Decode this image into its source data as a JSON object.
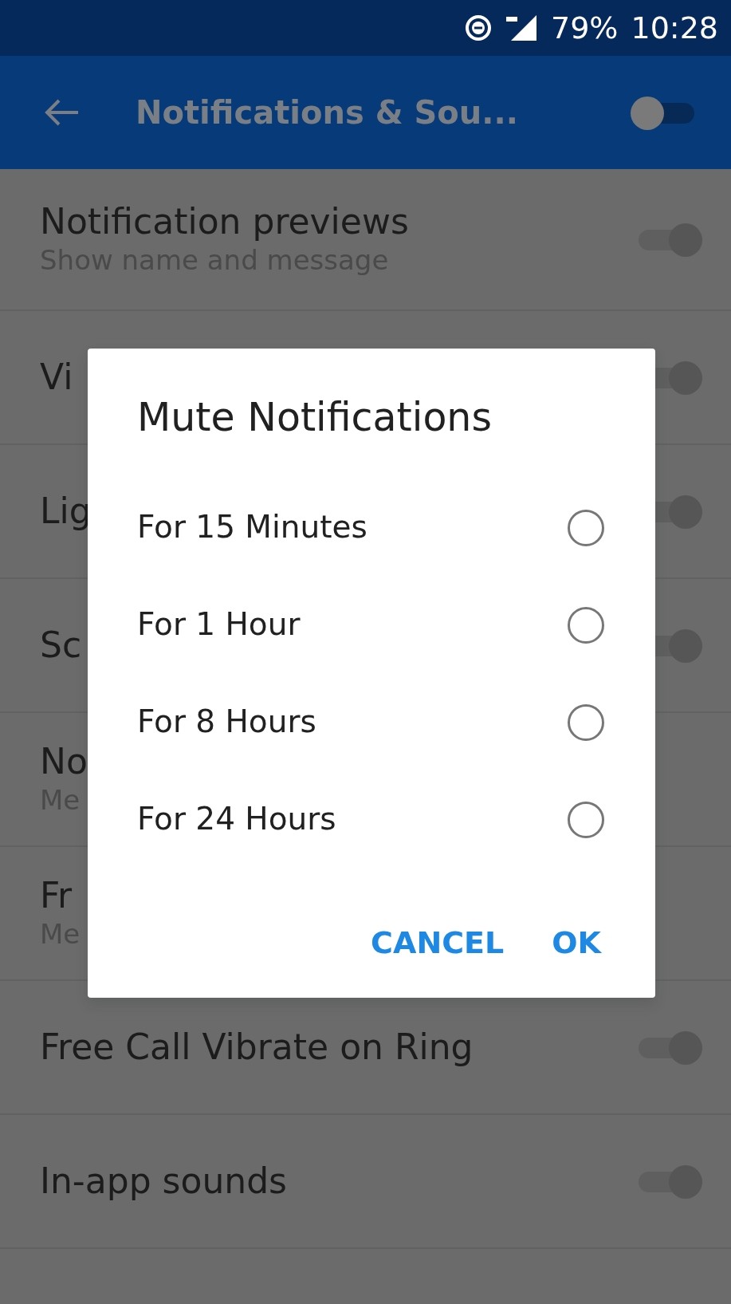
{
  "status_bar": {
    "battery": "79%",
    "time": "10:28"
  },
  "app_bar": {
    "title": "Notifications & Sou...",
    "toggle_on": false
  },
  "settings": [
    {
      "title": "Notification previews",
      "subtitle": "Show name and message",
      "on": true
    },
    {
      "title": "Vi",
      "on": true
    },
    {
      "title": "Lig",
      "on": true
    },
    {
      "title": "Sc",
      "on": true
    },
    {
      "title": "No",
      "subtitle": "Me"
    },
    {
      "title": "Fr",
      "subtitle": "Me"
    },
    {
      "title": "Free Call Vibrate on Ring",
      "on": true
    },
    {
      "title": "In-app sounds",
      "on": true
    }
  ],
  "dialog": {
    "title": "Mute Notifications",
    "options": [
      {
        "label": "For 15 Minutes",
        "selected": false
      },
      {
        "label": "For 1 Hour",
        "selected": false
      },
      {
        "label": "For 8 Hours",
        "selected": false
      },
      {
        "label": "For 24 Hours",
        "selected": false
      }
    ],
    "buttons": [
      "CANCEL",
      "OK"
    ]
  }
}
